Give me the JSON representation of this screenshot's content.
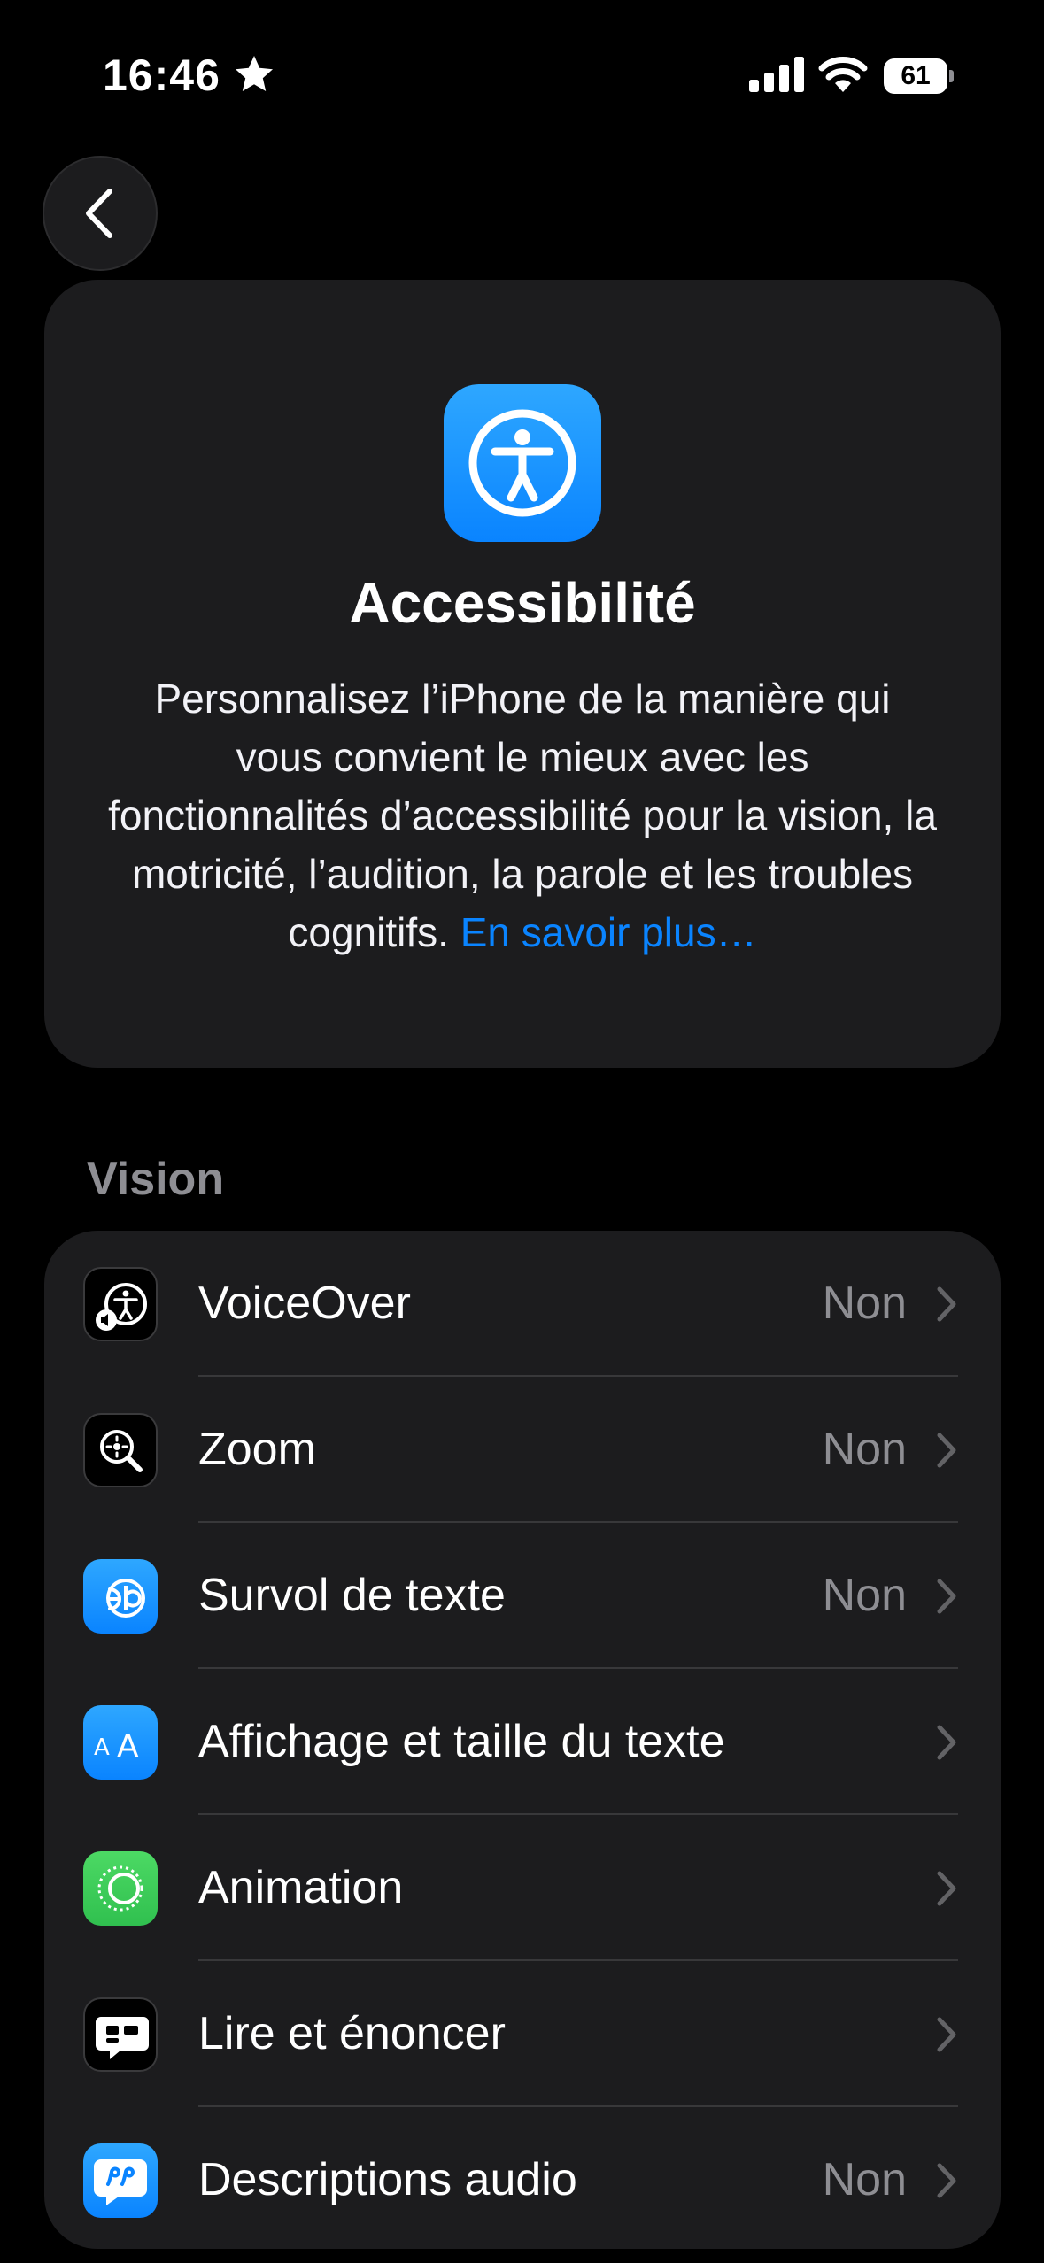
{
  "status_bar": {
    "time": "16:46",
    "battery": "61"
  },
  "header": {
    "title": "Accessibilité",
    "description": "Personnalisez l’iPhone de la manière qui vous convient le mieux avec les fonctionnalités d’accessibilité pour la vision, la motricité, l’audition, la parole et les troubles cognitifs.",
    "link": "En savoir plus…",
    "icon": "accessibility-icon"
  },
  "vision": {
    "title": "Vision",
    "items": [
      {
        "label": "VoiceOver",
        "value": "Non",
        "icon": "voiceover-icon"
      },
      {
        "label": "Zoom",
        "value": "Non",
        "icon": "zoom-icon"
      },
      {
        "label": "Survol de texte",
        "value": "Non",
        "icon": "hover-text-icon"
      },
      {
        "label": "Affichage et taille du texte",
        "value": "",
        "icon": "text-size-icon"
      },
      {
        "label": "Animation",
        "value": "",
        "icon": "animation-icon"
      },
      {
        "label": "Lire et énoncer",
        "value": "",
        "icon": "speech-icon"
      },
      {
        "label": "Descriptions audio",
        "value": "Non",
        "icon": "audio-descriptions-icon"
      }
    ]
  },
  "colors": {
    "accent": "#0a84ff",
    "card": "#1c1c1e",
    "secondary_text": "#8e8e93",
    "green": "#34c759"
  }
}
